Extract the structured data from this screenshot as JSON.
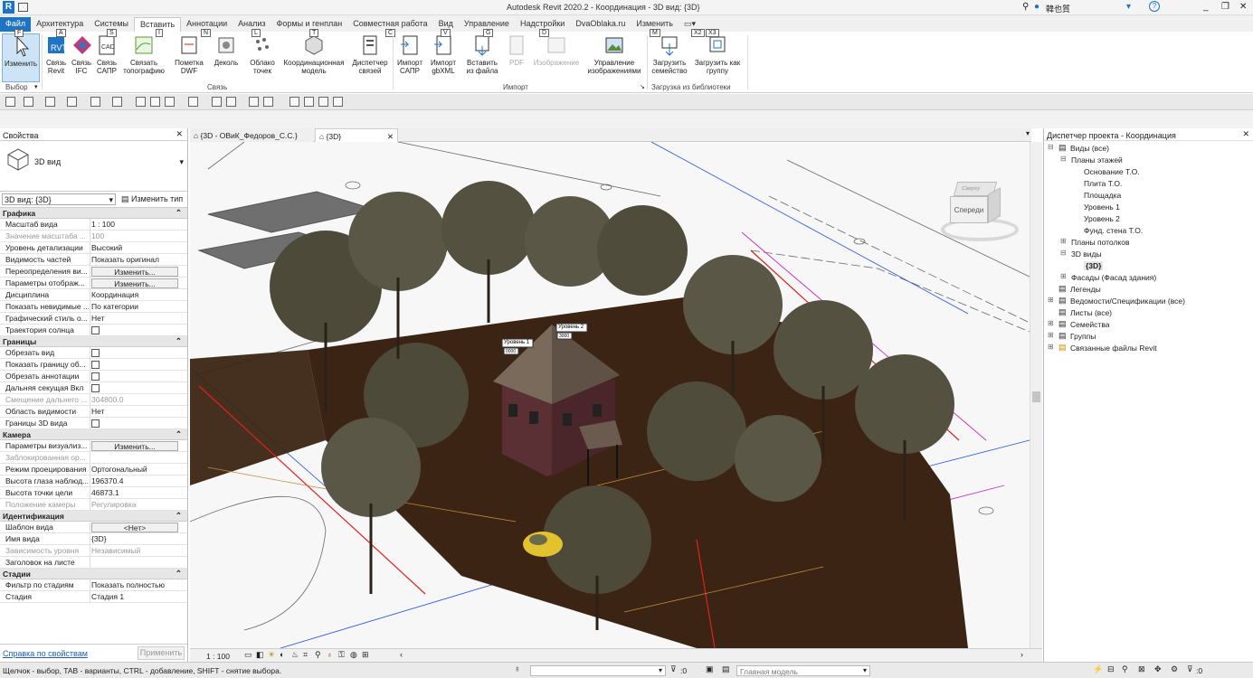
{
  "window": {
    "title": "Autodesk Revit 2020.2 - Координация - 3D вид: {3D}",
    "user": "韓也質"
  },
  "menu_tabs": [
    "Файл",
    "Архитектура",
    "Системы",
    "Вставить",
    "Аннотации",
    "Анализ",
    "Формы и генплан",
    "Совместная работа",
    "Вид",
    "Управление",
    "Надстройки",
    "DvaOblaka.ru",
    "Изменить"
  ],
  "active_tab": "Вставить",
  "ribbon": {
    "buttons": [
      {
        "id": "modify",
        "label": "Изменить",
        "icon": "cursor-icon"
      },
      {
        "id": "link-revit",
        "label": "Связь Revit",
        "icon": "revit-link-icon"
      },
      {
        "id": "link-ifc",
        "label": "Связь IFC",
        "icon": "ifc-link-icon"
      },
      {
        "id": "link-cad",
        "label": "Связь САПР",
        "icon": "cad-link-icon"
      },
      {
        "id": "link-topo",
        "label": "Связать топографию",
        "icon": "topography-icon"
      },
      {
        "id": "dwf-markup",
        "label": "Пометка DWF",
        "icon": "dwf-icon"
      },
      {
        "id": "decal",
        "label": "Деколь",
        "icon": "decal-icon"
      },
      {
        "id": "point-cloud",
        "label": "Облако точек",
        "icon": "point-cloud-icon"
      },
      {
        "id": "coord-model",
        "label": "Координационная модель",
        "icon": "coordination-model-icon"
      },
      {
        "id": "manage-links",
        "label": "Диспетчер связей",
        "icon": "manage-links-icon"
      },
      {
        "id": "import-cad",
        "label": "Импорт САПР",
        "icon": "import-cad-icon"
      },
      {
        "id": "import-gbxml",
        "label": "Импорт gbXML",
        "icon": "import-gbxml-icon"
      },
      {
        "id": "insert-from-file",
        "label": "Вставить из файла",
        "icon": "insert-file-icon"
      },
      {
        "id": "pdf",
        "label": "PDF",
        "icon": "pdf-icon"
      },
      {
        "id": "image",
        "label": "Изображение",
        "icon": "image-icon"
      },
      {
        "id": "manage-images",
        "label": "Управление изображениями",
        "icon": "manage-images-icon"
      },
      {
        "id": "load-family",
        "label": "Загрузить семейство",
        "icon": "load-family-icon"
      },
      {
        "id": "load-group",
        "label": "Загрузить как группу",
        "icon": "load-group-icon"
      }
    ],
    "panels": {
      "select": "Выбор",
      "link": "Связь",
      "import": "Импорт",
      "load": "Загрузка из библиотеки"
    },
    "keytips": [
      "F",
      "A",
      "S",
      "I",
      "N",
      "L",
      "T",
      "C",
      "V",
      "G",
      "D",
      "M",
      "X2",
      "X3"
    ]
  },
  "properties": {
    "header": "Свойства",
    "type_name": "3D вид",
    "instance_selector": "3D вид: {3D}",
    "edit_type": "Изменить тип",
    "groups": [
      {
        "name": "Графика",
        "rows": [
          {
            "k": "Масштаб вида",
            "v": "1 : 100"
          },
          {
            "k": "Значение масштаба ...",
            "v": "100",
            "dim": true
          },
          {
            "k": "Уровень детализации",
            "v": "Высокий"
          },
          {
            "k": "Видимость частей",
            "v": "Показать оригинал"
          },
          {
            "k": "Переопределения ви...",
            "v": "Изменить...",
            "btn": true
          },
          {
            "k": "Параметры отображ...",
            "v": "Изменить...",
            "btn": true
          },
          {
            "k": "Дисциплина",
            "v": "Координация"
          },
          {
            "k": "Показать невидимые ...",
            "v": "По категории"
          },
          {
            "k": "Графический стиль о...",
            "v": "Нет"
          },
          {
            "k": "Траектория солнца",
            "v": "",
            "cb": true
          }
        ]
      },
      {
        "name": "Границы",
        "rows": [
          {
            "k": "Обрезать вид",
            "v": "",
            "cb": true
          },
          {
            "k": "Показать границу об...",
            "v": "",
            "cb": true
          },
          {
            "k": "Обрезать аннотации",
            "v": "",
            "cb": true
          },
          {
            "k": "Дальняя секущая Вкл",
            "v": "",
            "cb": true
          },
          {
            "k": "Смещение дальнего ...",
            "v": "304800.0",
            "dim": true
          },
          {
            "k": "Область видимости",
            "v": "Нет"
          },
          {
            "k": "Границы 3D вида",
            "v": "",
            "cb": true
          }
        ]
      },
      {
        "name": "Камера",
        "rows": [
          {
            "k": "Параметры визуализ...",
            "v": "Изменить...",
            "btn": true
          },
          {
            "k": "Заблокированная ор...",
            "v": "",
            "dim": true
          },
          {
            "k": "Режим проецирования",
            "v": "Ортогональный"
          },
          {
            "k": "Высота глаза наблюд...",
            "v": "196370.4"
          },
          {
            "k": "Высота точки цели",
            "v": "46873.1"
          },
          {
            "k": "Положение камеры",
            "v": "Регулировка",
            "dim": true
          }
        ]
      },
      {
        "name": "Идентификация",
        "rows": [
          {
            "k": "Шаблон вида",
            "v": "<Нет>",
            "btn": true
          },
          {
            "k": "Имя вида",
            "v": "{3D}"
          },
          {
            "k": "Зависимость уровня",
            "v": "Независимый",
            "dim": true
          },
          {
            "k": "Заголовок на листе",
            "v": ""
          }
        ]
      },
      {
        "name": "Стадии",
        "rows": [
          {
            "k": "Фильтр по стадиям",
            "v": "Показать полностью"
          },
          {
            "k": "Стадия",
            "v": "Стадия 1"
          }
        ]
      }
    ],
    "help_link": "Справка по свойствам",
    "apply": "Применить"
  },
  "view_tabs": [
    {
      "label": "{3D - ОВиК_Федоров_С.С.}",
      "active": false
    },
    {
      "label": "{3D}",
      "active": true
    }
  ],
  "viewport": {
    "viewcube_face": "Спереди",
    "viewcube_top": "Сверху",
    "level_tags": [
      "Уровень 1",
      "Уровень 2"
    ],
    "level_values": [
      "0000",
      "3000"
    ],
    "scale": "1 : 100"
  },
  "browser": {
    "header": "Диспетчер проекта - Координация",
    "tree": [
      {
        "label": "Виды (все)",
        "level": 0,
        "exp": "-",
        "icon": "views-icon"
      },
      {
        "label": "Планы этажей",
        "level": 1,
        "exp": "-"
      },
      {
        "label": "Основание Т.О.",
        "level": 2
      },
      {
        "label": "Плита Т.О.",
        "level": 2
      },
      {
        "label": "Площадка",
        "level": 2
      },
      {
        "label": "Уровень 1",
        "level": 2
      },
      {
        "label": "Уровень 2",
        "level": 2
      },
      {
        "label": "Фунд. стена Т.О.",
        "level": 2
      },
      {
        "label": "Планы потолков",
        "level": 1,
        "exp": "+"
      },
      {
        "label": "3D виды",
        "level": 1,
        "exp": "-"
      },
      {
        "label": "{3D}",
        "level": 2,
        "bold": true
      },
      {
        "label": "Фасады (Фасад здания)",
        "level": 1,
        "exp": "+"
      },
      {
        "label": "Легенды",
        "level": 0,
        "icon": "legend-icon"
      },
      {
        "label": "Ведомости/Спецификации (все)",
        "level": 0,
        "exp": "+",
        "icon": "schedule-icon"
      },
      {
        "label": "Листы (все)",
        "level": 0,
        "icon": "sheet-icon"
      },
      {
        "label": "Семейства",
        "level": 0,
        "exp": "+",
        "icon": "family-icon"
      },
      {
        "label": "Группы",
        "level": 0,
        "exp": "+",
        "icon": "group-icon"
      },
      {
        "label": "Связанные файлы Revit",
        "level": 0,
        "exp": "+",
        "icon": "revit-links-icon"
      }
    ]
  },
  "status": {
    "hint": "Щелчок - выбор, TAB - варианты, CTRL - добавление, SHIFT - снятие выбора.",
    "filter_value": ":0",
    "model": "Главная модель",
    "filter_count": ":0"
  },
  "colors": {
    "accent": "#1e74c4",
    "ground": "#3a2413",
    "roof": "#6b5a4e",
    "brick": "#5a3034"
  }
}
